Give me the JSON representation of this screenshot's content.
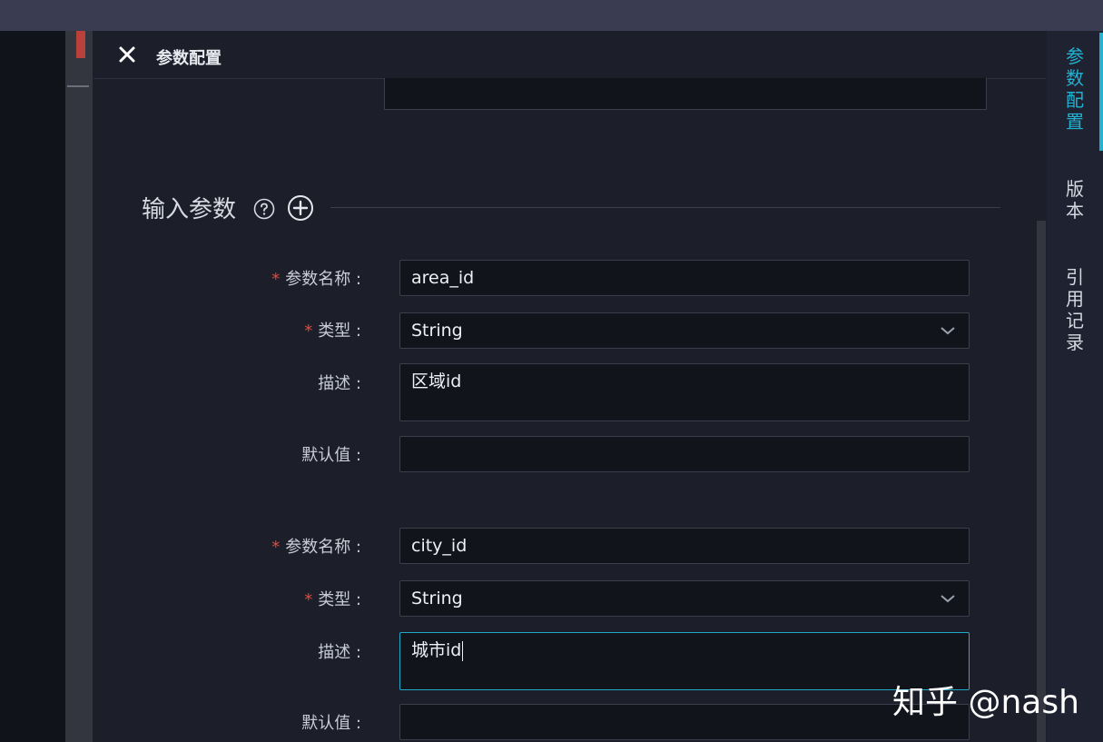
{
  "panel": {
    "title": "参数配置"
  },
  "section": {
    "title": "输入参数"
  },
  "params": [
    {
      "name_label": "参数名称 :",
      "name_value": "area_id",
      "type_label": "类型 :",
      "type_value": "String",
      "desc_label": "描述 :",
      "desc_value": "区域id",
      "default_label": "默认值 :",
      "default_value": ""
    },
    {
      "name_label": "参数名称 :",
      "name_value": "city_id",
      "type_label": "类型 :",
      "type_value": "String",
      "desc_label": "描述 :",
      "desc_value": "城市id",
      "default_label": "默认值 :",
      "default_value": ""
    }
  ],
  "right_tabs": [
    {
      "label": "参数配置",
      "active": true
    },
    {
      "label": "版本",
      "active": false
    },
    {
      "label": "引用记录",
      "active": false
    }
  ],
  "watermark": "知乎 @nash",
  "icons": {
    "close": "close-icon",
    "help": "help-circle-icon",
    "add": "plus-circle-icon",
    "dropdown": "chevron-down-icon"
  },
  "colors": {
    "accent": "#23b3d2",
    "required": "#e04b3e",
    "background": "#1c1f2a",
    "input_bg": "#11141b"
  }
}
